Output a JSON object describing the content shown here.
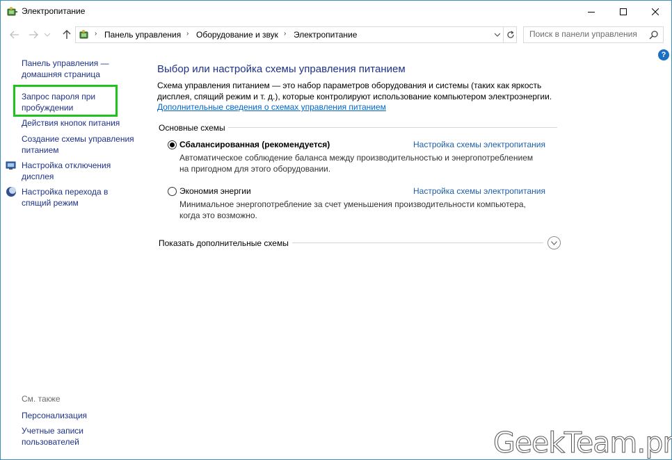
{
  "window": {
    "title": "Электропитание"
  },
  "nav": {
    "breadcrumbs": [
      "Панель управления",
      "Оборудование и звук",
      "Электропитание"
    ],
    "search_placeholder": "Поиск в панели управления"
  },
  "help": {
    "label": "?"
  },
  "sidebar": {
    "items": [
      {
        "label": "Панель управления — домашняя страница"
      },
      {
        "label": "Запрос пароля при пробуждении"
      },
      {
        "label": "Действия кнопок питания"
      },
      {
        "label": "Создание схемы управления питанием"
      },
      {
        "label": "Настройка отключения дисплея",
        "icon": "display-power-icon"
      },
      {
        "label": "Настройка перехода в спящий режим",
        "icon": "sleep-moon-icon"
      }
    ],
    "see_also_label": "См. также",
    "see_also": [
      {
        "label": "Персонализация"
      },
      {
        "label": "Учетные записи пользователей"
      }
    ]
  },
  "main": {
    "title": "Выбор или настройка схемы управления питанием",
    "description": "Схема управления питанием — это набор параметров оборудования и системы (таких как яркость дисплея, спящий режим и т. д.), которые контролируют использование компьютером электроэнергии.",
    "more_link": "Дополнительные сведения о схемах управления питанием",
    "group_label": "Основные схемы",
    "plans": [
      {
        "name": "Сбалансированная (рекомендуется)",
        "selected": true,
        "link": "Настройка схемы электропитания",
        "description": "Автоматическое соблюдение баланса между производительностью и энергопотреблением на пригодном для этого оборудовании."
      },
      {
        "name": "Экономия энергии",
        "selected": false,
        "link": "Настройка схемы электропитания",
        "description": "Минимальное энергопотребление за счет уменьшения производительности компьютера, когда это возможно."
      }
    ],
    "show_more": "Показать дополнительные схемы"
  },
  "watermark": "GeekTeam.pro",
  "colors": {
    "link": "#1e3287",
    "highlight": "#1ec31e",
    "title_blue": "#1e3287"
  }
}
